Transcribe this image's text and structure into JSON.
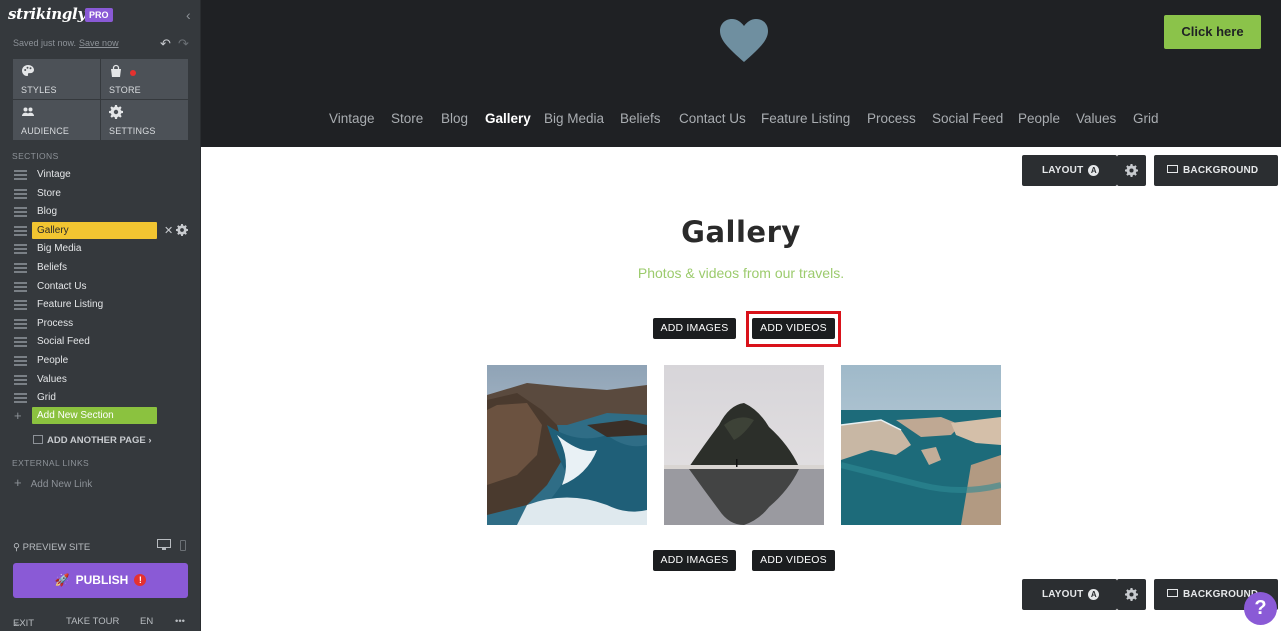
{
  "sidebar": {
    "brand": "strikingly",
    "badge": "PRO",
    "saved_text": "Saved just now.",
    "save_now": "Save now",
    "tiles": [
      {
        "label": "STYLES",
        "icon": "palette-icon"
      },
      {
        "label": "STORE",
        "icon": "shopping-bag-icon"
      },
      {
        "label": "AUDIENCE",
        "icon": "people-icon"
      },
      {
        "label": "SETTINGS",
        "icon": "gear-icon"
      }
    ],
    "sections_heading": "SECTIONS",
    "sections": [
      "Vintage",
      "Store",
      "Blog",
      "Gallery",
      "Big Media",
      "Beliefs",
      "Contact Us",
      "Feature Listing",
      "Process",
      "Social Feed",
      "People",
      "Values",
      "Grid"
    ],
    "active_section": "Gallery",
    "add_new_section": "Add New Section",
    "add_another_page": "ADD ANOTHER PAGE",
    "external_links_heading": "EXTERNAL LINKS",
    "add_new_link": "Add New Link",
    "preview_site": "PREVIEW SITE",
    "publish": "PUBLISH",
    "publish_warning": "!",
    "bottom": {
      "exit": "EXIT",
      "tour": "TAKE TOUR",
      "lang": "EN",
      "more": "•••"
    }
  },
  "header": {
    "cta": "Click here",
    "nav": [
      "Vintage",
      "Store",
      "Blog",
      "Gallery",
      "Big Media",
      "Beliefs",
      "Contact Us",
      "Feature Listing",
      "Process",
      "Social Feed",
      "People",
      "Values",
      "Grid"
    ],
    "current_nav": "Gallery",
    "logo_color": "#6f8fa0",
    "accent_color": "#8bc34a"
  },
  "toolbar": {
    "layout": "LAYOUT",
    "layout_badge": "A",
    "background": "BACKGROUND"
  },
  "gallery": {
    "title": "Gallery",
    "subtitle": "Photos & videos from our travels.",
    "add_images": "ADD IMAGES",
    "add_videos": "ADD VIDEOS",
    "photos": [
      {
        "name": "coastal-rocks-waves-photo"
      },
      {
        "name": "sea-stack-reflection-photo"
      },
      {
        "name": "coastal-cliffs-aerial-photo"
      }
    ]
  },
  "help": "?"
}
